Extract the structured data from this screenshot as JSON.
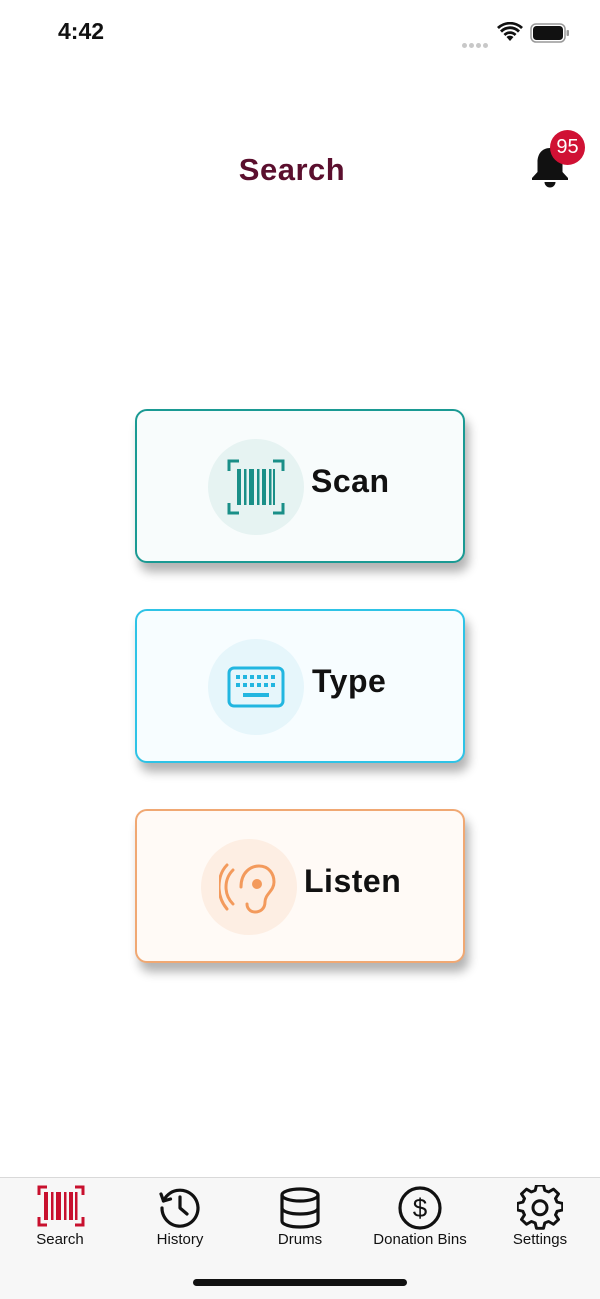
{
  "status_bar": {
    "time": "4:42"
  },
  "header": {
    "title": "Search",
    "notification_count": "95"
  },
  "actions": {
    "scan": {
      "label": "Scan",
      "icon": "barcode-scan-icon",
      "color": "#1a9a93"
    },
    "type": {
      "label": "Type",
      "icon": "keyboard-icon",
      "color": "#2ec3e6"
    },
    "listen": {
      "label": "Listen",
      "icon": "ear-icon",
      "color": "#f0a873"
    }
  },
  "tab_bar": {
    "active": "search",
    "active_color": "#c8102e",
    "items": [
      {
        "id": "search",
        "label": "Search",
        "icon": "barcode-icon"
      },
      {
        "id": "history",
        "label": "History",
        "icon": "history-icon"
      },
      {
        "id": "drums",
        "label": "Drums",
        "icon": "database-icon"
      },
      {
        "id": "donation-bins",
        "label": "Donation Bins",
        "icon": "dollar-icon"
      },
      {
        "id": "settings",
        "label": "Settings",
        "icon": "gear-icon"
      }
    ]
  }
}
